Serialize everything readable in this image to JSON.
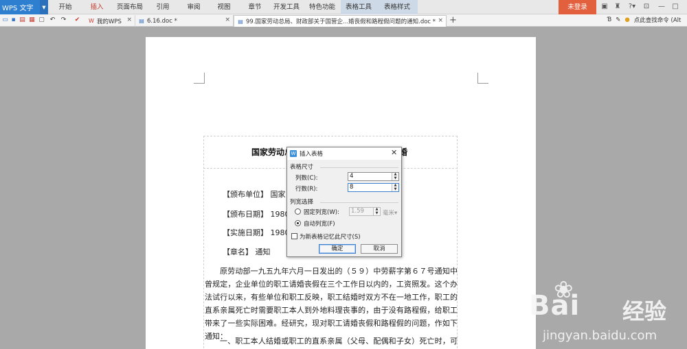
{
  "app": {
    "logo": "WPS 文字",
    "menu": [
      "开始",
      "插入",
      "页面布局",
      "引用",
      "审阅",
      "视图",
      "章节",
      "开发工具",
      "特色功能",
      "表格工具",
      "表格样式"
    ],
    "login": "未登录"
  },
  "tabs": [
    {
      "label": "我的WPS"
    },
    {
      "label": "6.16.doc *"
    },
    {
      "label": "99.国家劳动总局、财政部关于国营企...婚丧假和路程假问题的通知.doc *"
    }
  ],
  "toolbar_right": {
    "search_hint": "点此查找命令 (Alt"
  },
  "document": {
    "title_head": "国家劳动总",
    "title_tail": "婚",
    "fields": [
      {
        "label": "【颁布单位】",
        "value": "国家"
      },
      {
        "label": "【颁布日期】",
        "value": "1980"
      },
      {
        "label": "【实施日期】",
        "value": "1980"
      },
      {
        "label": "【章名】",
        "value": "通知"
      }
    ],
    "para1": "原劳动部一九五九年六月一日发出的（５９）中劳薪字第６７号通知中曾规定，企业单位的职工请婚丧假在三个工作日以内的，工资照发。这个办法试行以来，有些单位和职工反映，职工结婚时双方不在一地工作，职工的直系亲属死亡时需要职工本人到外地料理丧事的，由于没有路程假，给职工带来了一些实际困难。经研究，现对职工请婚丧假和路程假的问题，作如下通知：",
    "para2": "一、职工本人结婚或职工的直系亲属（父母、配偶和子女）死亡时，可以根据具体情况，由本单位行政领导批准，酌情给予一至三天的婚丧假。"
  },
  "dialog": {
    "title": "插入表格",
    "size_group": "表格尺寸",
    "cols_label": "列数(C):",
    "cols_value": "4",
    "rows_label": "行数(R):",
    "rows_value": "8",
    "width_group": "列宽选择",
    "fixed_label": "固定列宽(W):",
    "fixed_value": "1.59",
    "fixed_unit": "毫米",
    "auto_label": "自动列宽(F)",
    "remember_label": "为新表格记忆此尺寸(S)",
    "ok": "确定",
    "cancel": "取消"
  },
  "watermark": {
    "brand": "Bai",
    "brand2": "经验",
    "url": "jingyan.baidu.com"
  }
}
